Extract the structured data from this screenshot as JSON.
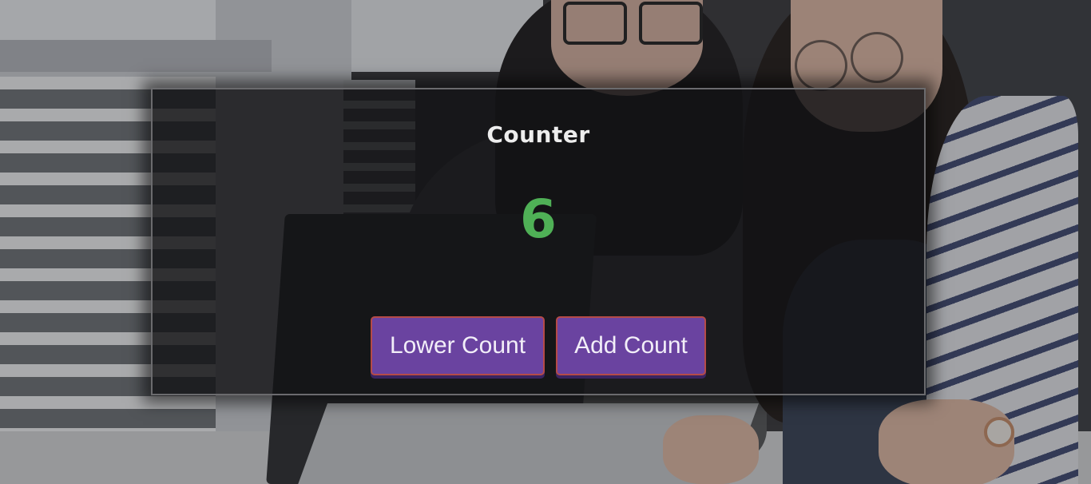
{
  "counter": {
    "title": "Counter",
    "value": "6",
    "value_color": "#4fb056"
  },
  "buttons": {
    "lower_label": "Lower Count",
    "add_label": "Add Count",
    "accent": "#6a43a0",
    "border_color": "#b54b48"
  }
}
